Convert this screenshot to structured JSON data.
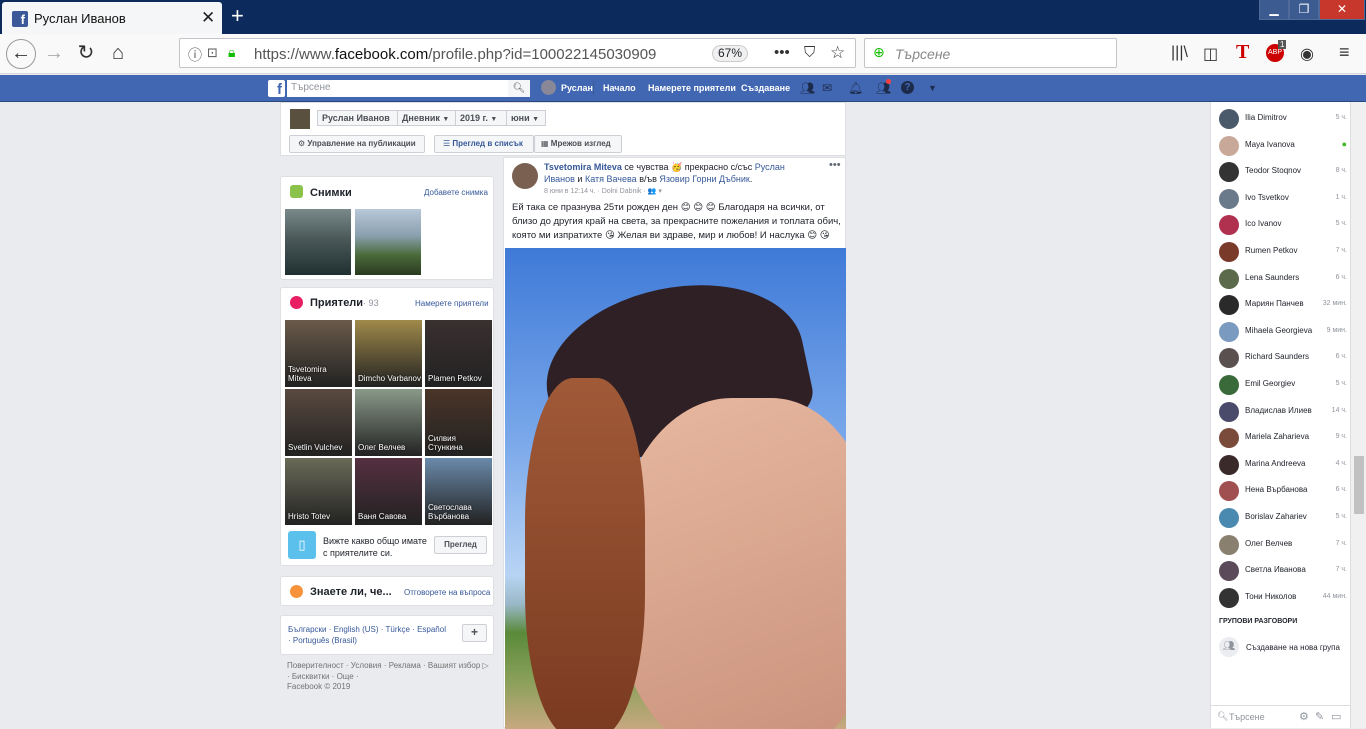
{
  "browser": {
    "tab_title": "Руслан Иванов",
    "url_prefix": "https://www.",
    "url_host": "facebook.com",
    "url_rest": "/profile.php?id=100022145030909",
    "zoom": "67%",
    "search_placeholder": "Търсене",
    "abp_badge": "1"
  },
  "fb": {
    "search_placeholder": "Търсене",
    "profile_name": "Руслан",
    "nav": [
      "Начало",
      "Намерете приятели",
      "Създаване"
    ]
  },
  "timeline": {
    "name": "Руслан Иванов",
    "section": "Дневник",
    "year": "2019 г.",
    "month": "юни",
    "manage": "Управление на публикации",
    "list_view": "Преглед в списък",
    "grid_view": "Мрежов изглед"
  },
  "photos": {
    "title": "Снимки",
    "add": "Добавете снимка"
  },
  "friends": {
    "title": "Приятели",
    "count": "· 93",
    "find": "Намерете приятели",
    "items": [
      {
        "name": "Tsvetomira Miteva",
        "color": "#6a5a4a"
      },
      {
        "name": "Dimcho Varbanov",
        "color": "#a08a4a"
      },
      {
        "name": "Plamen Petkov",
        "color": "#3a3030"
      },
      {
        "name": "Svetlin Vulchev",
        "color": "#5a4a40"
      },
      {
        "name": "Олег Велчев",
        "color": "#8a9a8a"
      },
      {
        "name": "Силвия Стункина",
        "color": "#4a3528"
      },
      {
        "name": "Hristo Totev",
        "color": "#6a6a58"
      },
      {
        "name": "Ваня Савова",
        "color": "#553040"
      },
      {
        "name": "Светослава Върбанова",
        "color": "#6a8aaa"
      }
    ],
    "common_text": "Вижте какво общо имате с приятелите си.",
    "common_btn": "Преглед"
  },
  "knowyou": {
    "title": "Знаете ли, че...",
    "answer": "Отговорете на въпроса"
  },
  "footer": {
    "langs": "Български · English (US) · Türkçe · Español · Português (Brasil)",
    "links": "Поверителност · Условия · Реклама · Вашият избор ▷ · Бисквитки · Още ·",
    "copy": "Facebook © 2019"
  },
  "post": {
    "author": "Tsvetomira Miteva",
    "feeling": " се чувства 🥳 прекрасно с/със ",
    "with1": "Руслан Иванов",
    "and": " и ",
    "with2": "Катя Вачева",
    "at": " в/ъв ",
    "place": "Язовир Горни Дъбник",
    "meta": "8 юни в 12:14 ч. · Dolni Dabnik · 👥 ▾",
    "text": "Ей така се празнува 25ти рожден ден 😊 😊 😊 Благодаря на всички, от близо до другия край на света, за прекрасните пожелания и топлата обич, която ми изпратихте 😘 Желая ви здраве, мир и любов! И наслука 😊 😘"
  },
  "chat": {
    "contacts": [
      {
        "name": "Ilia Dimitrov",
        "time": "5 ч.",
        "color": "#4a5a6a"
      },
      {
        "name": "Maya Ivanova",
        "time": "●",
        "color": "#c8a898"
      },
      {
        "name": "Teodor Stoqnov",
        "time": "8 ч.",
        "color": "#333"
      },
      {
        "name": "Ivo Tsvetkov",
        "time": "1 ч.",
        "color": "#6a7a8a"
      },
      {
        "name": "Ico Ivanov",
        "time": "5 ч.",
        "color": "#b03050"
      },
      {
        "name": "Rumen Petkov",
        "time": "7 ч.",
        "color": "#7a3a2a"
      },
      {
        "name": "Lena Saunders",
        "time": "6 ч.",
        "color": "#5a6a4a"
      },
      {
        "name": "Мариян Панчев",
        "time": "32 мин.",
        "color": "#2a2a2a"
      },
      {
        "name": "Mihaela Georgieva",
        "time": "9 мин.",
        "color": "#7a9ac0"
      },
      {
        "name": "Richard Saunders",
        "time": "6 ч.",
        "color": "#5a5050"
      },
      {
        "name": "Emil Georgiev",
        "time": "5 ч.",
        "color": "#3a6a3a"
      },
      {
        "name": "Владислав Илиев",
        "time": "14 ч.",
        "color": "#4a4a6a"
      },
      {
        "name": "Mariela Zaharieva",
        "time": "9 ч.",
        "color": "#7a4a3a"
      },
      {
        "name": "Marina Andreeva",
        "time": "4 ч.",
        "color": "#3a2a2a"
      },
      {
        "name": "Нена Върбанова",
        "time": "6 ч.",
        "color": "#a05050"
      },
      {
        "name": "Borislav Zahariev",
        "time": "5 ч.",
        "color": "#4a8ab0"
      },
      {
        "name": "Олег Велчев",
        "time": "7 ч.",
        "color": "#8a8070"
      },
      {
        "name": "Светла Иванова",
        "time": "7 ч.",
        "color": "#5a4a5a"
      },
      {
        "name": "Тони Николов",
        "time": "44 мин.",
        "color": "#333"
      }
    ],
    "groups_title": "ГРУПОВИ РАЗГОВОРИ",
    "new_group": "Създаване на нова група",
    "search_placeholder": "Търсене"
  }
}
